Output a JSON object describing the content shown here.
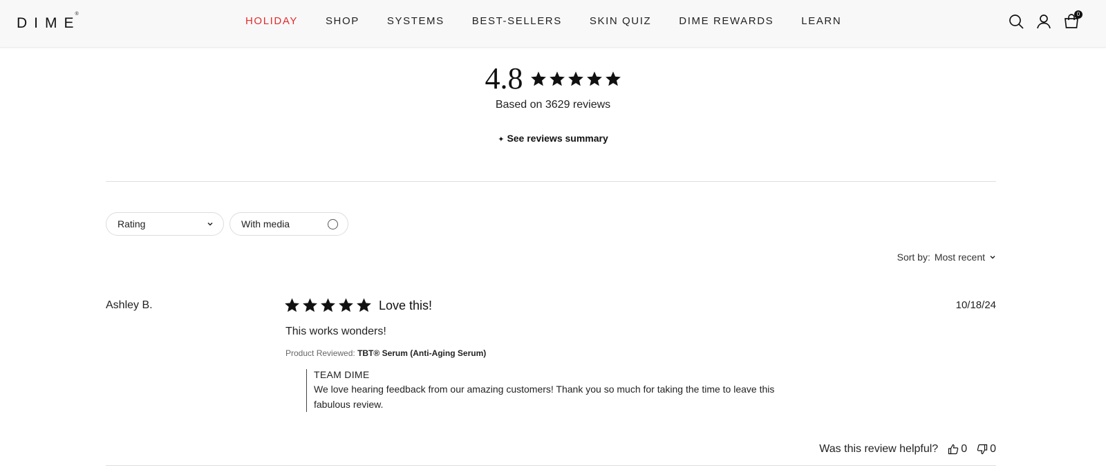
{
  "header": {
    "logo": "DIME",
    "logo_mark": "®",
    "nav": [
      {
        "label": "HOLIDAY",
        "active": true
      },
      {
        "label": "SHOP",
        "active": false
      },
      {
        "label": "SYSTEMS",
        "active": false
      },
      {
        "label": "BEST-SELLERS",
        "active": false
      },
      {
        "label": "SKIN QUIZ",
        "active": false
      },
      {
        "label": "DIME REWARDS",
        "active": false
      },
      {
        "label": "LEARN",
        "active": false
      }
    ],
    "icons": [
      "search-icon",
      "account-icon",
      "cart-icon"
    ],
    "cart_count": "0"
  },
  "summary": {
    "average": "4.8",
    "stars": 5,
    "based_on": "Based on 3629 reviews",
    "summary_link": "See reviews summary",
    "summary_icon": "✦"
  },
  "filters": {
    "rating_label": "Rating",
    "media_label": "With media"
  },
  "sort": {
    "label": "Sort by:",
    "value": "Most recent"
  },
  "review": {
    "author": "Ashley B.",
    "rating": 5,
    "title": "Love this!",
    "date": "10/18/24",
    "body": "This works wonders!",
    "product_label": "Product Reviewed:",
    "product_name": "TBT® Serum (Anti-Aging Serum)",
    "reply_author": "TEAM DIME",
    "reply_text": "We love hearing feedback from our amazing customers! Thank you so much for taking the time to leave this fabulous review.",
    "helpful_label": "Was this review helpful?",
    "upvotes": "0",
    "downvotes": "0"
  },
  "colors": {
    "accent": "#e32b2b",
    "text": "#111111",
    "divider": "#dedede"
  }
}
